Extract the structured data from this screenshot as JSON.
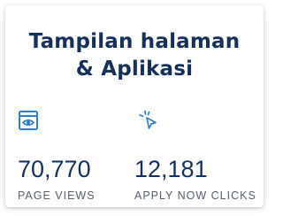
{
  "card": {
    "title_line1": "Tampilan halaman",
    "title_line2": "& Aplikasi"
  },
  "stats": [
    {
      "icon": "browser-eye-icon",
      "value": "70,770",
      "label": "PAGE VIEWS"
    },
    {
      "icon": "cursor-click-icon",
      "value": "12,181",
      "label": "APPLY NOW CLICKS"
    }
  ],
  "colors": {
    "title": "#16305e",
    "value": "#16305e",
    "label": "#5a6070",
    "icon": "#2f7dd6"
  }
}
